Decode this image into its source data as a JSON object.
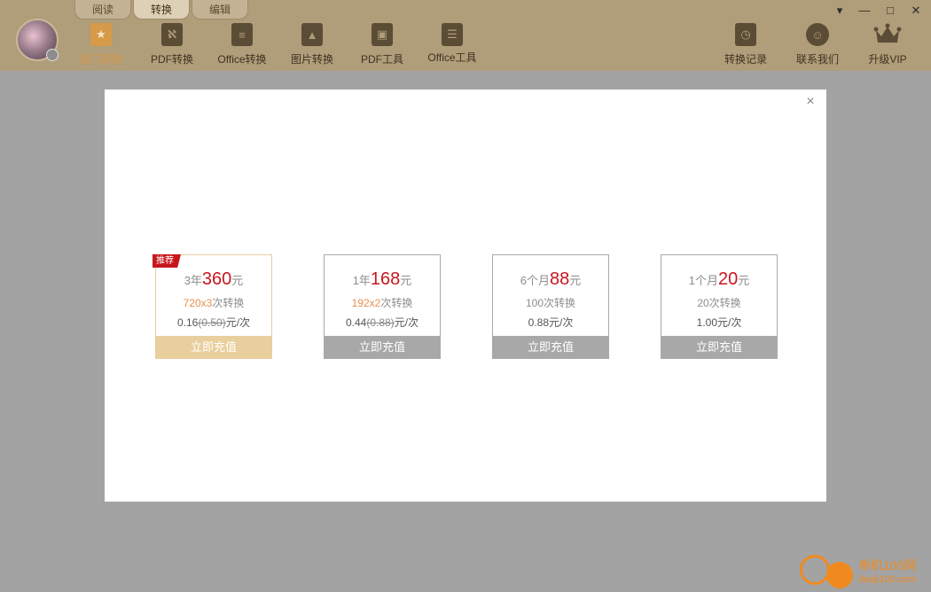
{
  "tabs": [
    {
      "label": "阅读"
    },
    {
      "label": "转换"
    },
    {
      "label": "编辑"
    }
  ],
  "nav": [
    {
      "label": "热门转换",
      "icon": "star-icon"
    },
    {
      "label": "PDF转换",
      "icon": "pdf-icon"
    },
    {
      "label": "Office转换",
      "icon": "document-icon"
    },
    {
      "label": "图片转换",
      "icon": "image-icon"
    },
    {
      "label": "PDF工具",
      "icon": "toolbox-icon"
    },
    {
      "label": "Office工具",
      "icon": "briefcase-icon"
    }
  ],
  "right_nav": [
    {
      "label": "转换记录",
      "icon": "history-icon"
    },
    {
      "label": "联系我们",
      "icon": "headset-icon"
    },
    {
      "label": "升级VIP",
      "icon": "crown-icon"
    }
  ],
  "window": {
    "menu": "▾",
    "minimize": "—",
    "maximize": "□",
    "close": "✕"
  },
  "modal": {
    "close": "×",
    "plans": [
      {
        "badge": "推荐",
        "period": "3年",
        "price": "360",
        "currency": "元",
        "count_hl": "720x3",
        "count_suffix": "次转换",
        "unit_price": "0.16",
        "unit_old": "(0.50)",
        "unit_suffix": "元/次",
        "button": "立即充值"
      },
      {
        "badge": "",
        "period": "1年",
        "price": "168",
        "currency": "元",
        "count_hl": "192x2",
        "count_suffix": "次转换",
        "unit_price": "0.44",
        "unit_old": "(0.88)",
        "unit_suffix": "元/次",
        "button": "立即充值"
      },
      {
        "badge": "",
        "period": "6个月",
        "price": "88",
        "currency": "元",
        "count_hl": "",
        "count_suffix": "100次转换",
        "unit_price": "0.88",
        "unit_old": "",
        "unit_suffix": "元/次",
        "button": "立即充值"
      },
      {
        "badge": "",
        "period": "1个月",
        "price": "20",
        "currency": "元",
        "count_hl": "",
        "count_suffix": "20次转换",
        "unit_price": "1.00",
        "unit_old": "",
        "unit_suffix": "元/次",
        "button": "立即充值"
      }
    ]
  },
  "watermark": {
    "line1": "单机100网",
    "line2": "danji100.com"
  },
  "colors": {
    "topbar": "#b09d79",
    "accent": "#d69a49",
    "price_red": "#c8161d",
    "overlay": "#a3a3a3"
  }
}
